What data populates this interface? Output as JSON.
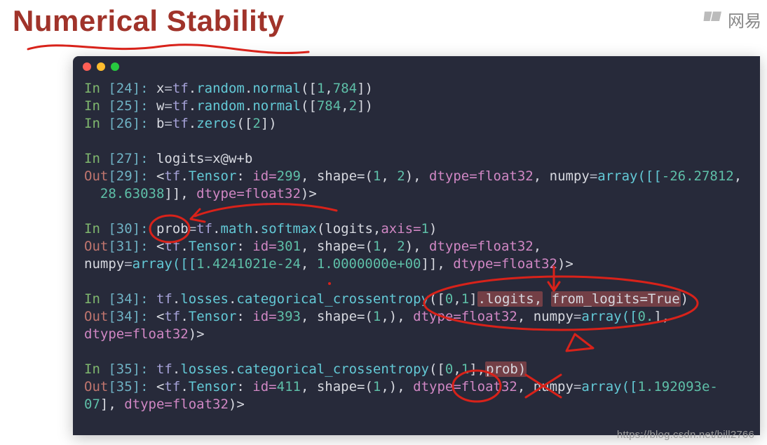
{
  "title": "Numerical Stability",
  "watermark_text": "网易",
  "footer_url": "https://blog.csdn.net/bill2766",
  "highlights": {
    "h1": ".logits,",
    "h2": "from_logits=True",
    "h3": "prob)"
  },
  "prompts": {
    "in24": "In ",
    "in25": "In ",
    "in26": "In ",
    "in27": "In ",
    "in30": "In ",
    "in34": "In ",
    "in35": "In ",
    "out29": "Out",
    "out31": "Out",
    "out34": "Out",
    "out35": "Out",
    "n24": "[24]:",
    "n25": "[25]:",
    "n26": "[26]:",
    "n27": "[27]:",
    "n29": "[29]:",
    "n30": "[30]:",
    "n31": "[31]:",
    "n34a": "[34]:",
    "n34b": "[34]:",
    "n35a": "[35]:",
    "n35b": "[35]:"
  },
  "code": {
    "l1a": " x",
    "l1op": "=",
    "l1m": "tf",
    "l1d1": ".",
    "l1mod": "random",
    "l1d2": ".",
    "l1fn": "normal",
    "l1args": "([",
    "l1n1": "1",
    "l1c": ",",
    "l1n2": "784",
    "l1end": "])",
    "l2a": " w",
    "l2fn": "normal",
    "l2args": "([",
    "l2n1": "784",
    "l2c": ",",
    "l2n2": "2",
    "l2end": "])",
    "l3a": " b",
    "l3fn": "zeros",
    "l3args": "([",
    "l3n": "2",
    "l3end": "])",
    "l4a": " logits",
    "l4expr": "x@w+b",
    "o29a": " <",
    "o29m": "tf",
    "o29d": ".",
    "o29t": "Tensor",
    "o29c": ": ",
    "o29k1": "id=",
    "o29n1": "299",
    "o29s": ", shape=(",
    "o29n2": "1",
    "o29s2": ", ",
    "o29n3": "2",
    "o29s3": "), ",
    "o29k2": "dtype=float32",
    "o29s4": ", numpy",
    "o29op": "=",
    "o29arr": "array([[",
    "o29v1": "-26.27812",
    "o29s5": ",\n  ",
    "o29v2": "28.63038",
    "o29s6": "]], ",
    "o29k3": "dtype=float32",
    "o29end": ")>",
    "l30a": " prob",
    "l30m": "tf",
    "l30mod": "math",
    "l30fn": "softmax",
    "l30args": "(logits,",
    "l30k": "axis=",
    "l30n": "1",
    "l30end": ")",
    "o31a": " <",
    "o31t": "Tensor",
    "o31c": ": ",
    "o31k1": "id=",
    "o31n1": "301",
    "o31s": ", shape=(",
    "o31n2": "1",
    "o31s2": ", ",
    "o31n3": "2",
    "o31s3": "), ",
    "o31k2": "dtype=float32",
    "o31s4": ",\nnumpy",
    "o31arr": "array([[",
    "o31v1": "1.4241021e-24",
    "o31s5": ", ",
    "o31v2": "1.0000000e+00",
    "o31s6": "]], ",
    "o31k3": "dtype=float32",
    "o31end": ")>",
    "l34a": " ",
    "l34m": "tf",
    "l34mod": "losses",
    "l34fn": "categorical_crossentropy",
    "l34args": "([",
    "l34n1": "0",
    "l34c": ",",
    "l34n2": "1",
    "l34mid": "]",
    "l34end": ")",
    "o34a": " <",
    "o34t": "Tensor",
    "o34c": ": ",
    "o34k1": "id=",
    "o34n1": "393",
    "o34s": ", shape=(",
    "o34n2": "1",
    "o34s2": ",), ",
    "o34k2": "dtype=float32",
    "o34s3": ", numpy",
    "o34arr": "array([",
    "o34v": "0.",
    "o34s4": "],\n",
    "o34k3": "dtype=float32",
    "o34end": ")>",
    "l35fn": "categorical_crossentropy",
    "l35args": "([",
    "l35n1": "0",
    "l35c": ",",
    "l35n2": "1",
    "l35mid": "],",
    "o35a": " <",
    "o35t": "Tensor",
    "o35c": ": ",
    "o35k1": "id=",
    "o35n1": "411",
    "o35s": ", shape=(",
    "o35n2": "1",
    "o35s2": ",), ",
    "o35k2": "dtype=float32",
    "o35s3": ", numpy",
    "o35arr": "array([",
    "o35v": "1.192093e-\n07",
    "o35s4": "], ",
    "o35k3": "dtype=float32",
    "o35end": ")>"
  },
  "annotation_strokes": {
    "color": "#d8221a",
    "regions": [
      "title-underline-swoosh",
      "circle-around-prob-line30",
      "arrow-from-softmax-to-prob",
      "oval-around-logits-and-from_logits",
      "arrow-down-into-from_logits",
      "circle-around-prob-line35",
      "large-X-after-prob-line35",
      "small-triangle-near-line34",
      "stray-dot"
    ]
  }
}
